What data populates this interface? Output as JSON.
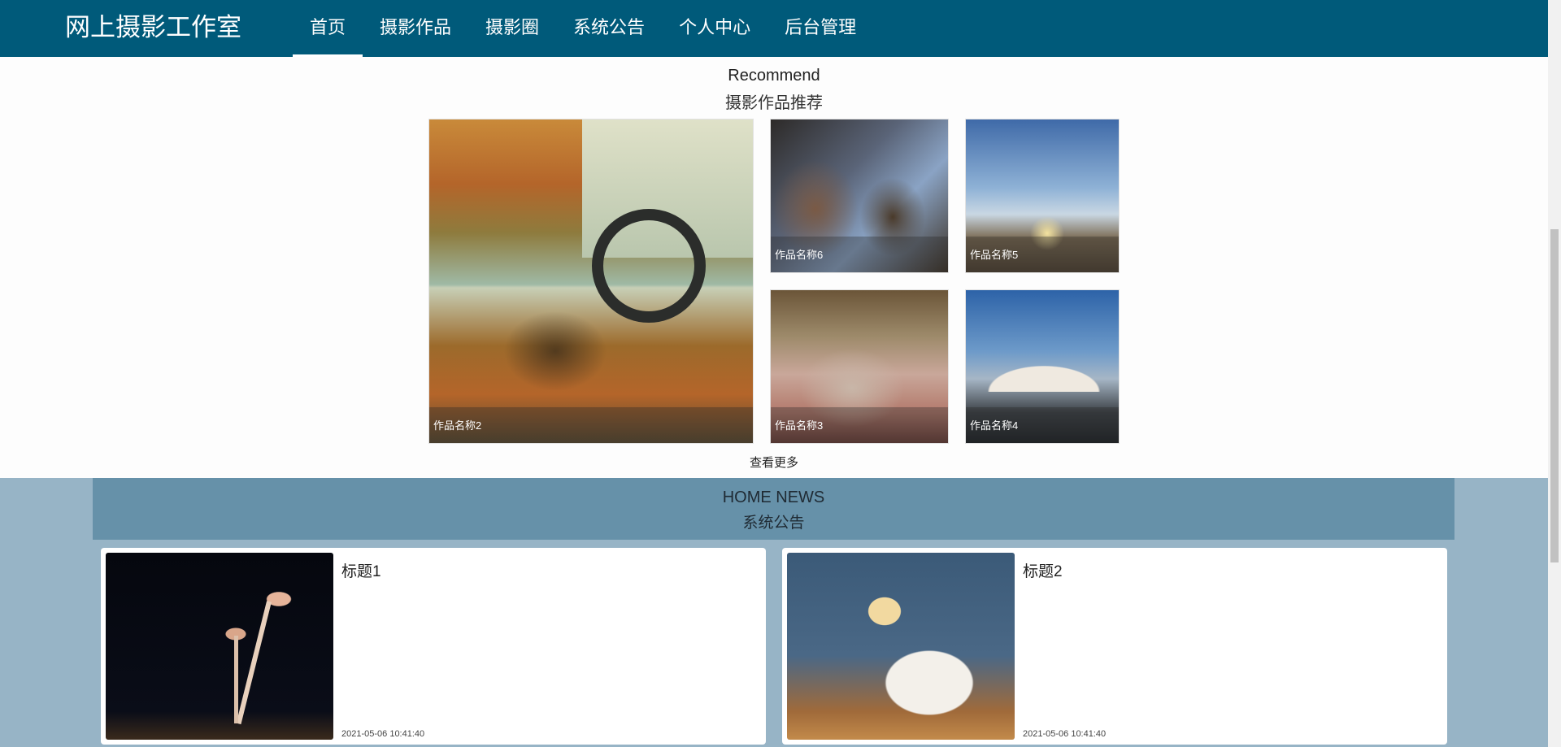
{
  "navbar": {
    "brand": "网上摄影工作室",
    "items": [
      {
        "label": "首页",
        "active": true
      },
      {
        "label": "摄影作品",
        "active": false
      },
      {
        "label": "摄影圈",
        "active": false
      },
      {
        "label": "系统公告",
        "active": false
      },
      {
        "label": "个人中心",
        "active": false
      },
      {
        "label": "后台管理",
        "active": false
      }
    ]
  },
  "recommend": {
    "title_en": "Recommend",
    "title_cn": "摄影作品推荐",
    "works": [
      {
        "name": "作品名称2"
      },
      {
        "name": "作品名称6"
      },
      {
        "name": "作品名称5"
      },
      {
        "name": "作品名称3"
      },
      {
        "name": "作品名称4"
      }
    ],
    "more_label": "查看更多"
  },
  "news": {
    "title_en": "HOME NEWS",
    "title_cn": "系统公告",
    "items": [
      {
        "title": "标题1",
        "date": "2021-05-06 10:41:40"
      },
      {
        "title": "标题2",
        "date": "2021-05-06 10:41:40"
      }
    ]
  },
  "colors": {
    "navbar_bg": "#005a7a",
    "news_bg": "#97b4c6",
    "news_header_bg": "#6691a9"
  }
}
